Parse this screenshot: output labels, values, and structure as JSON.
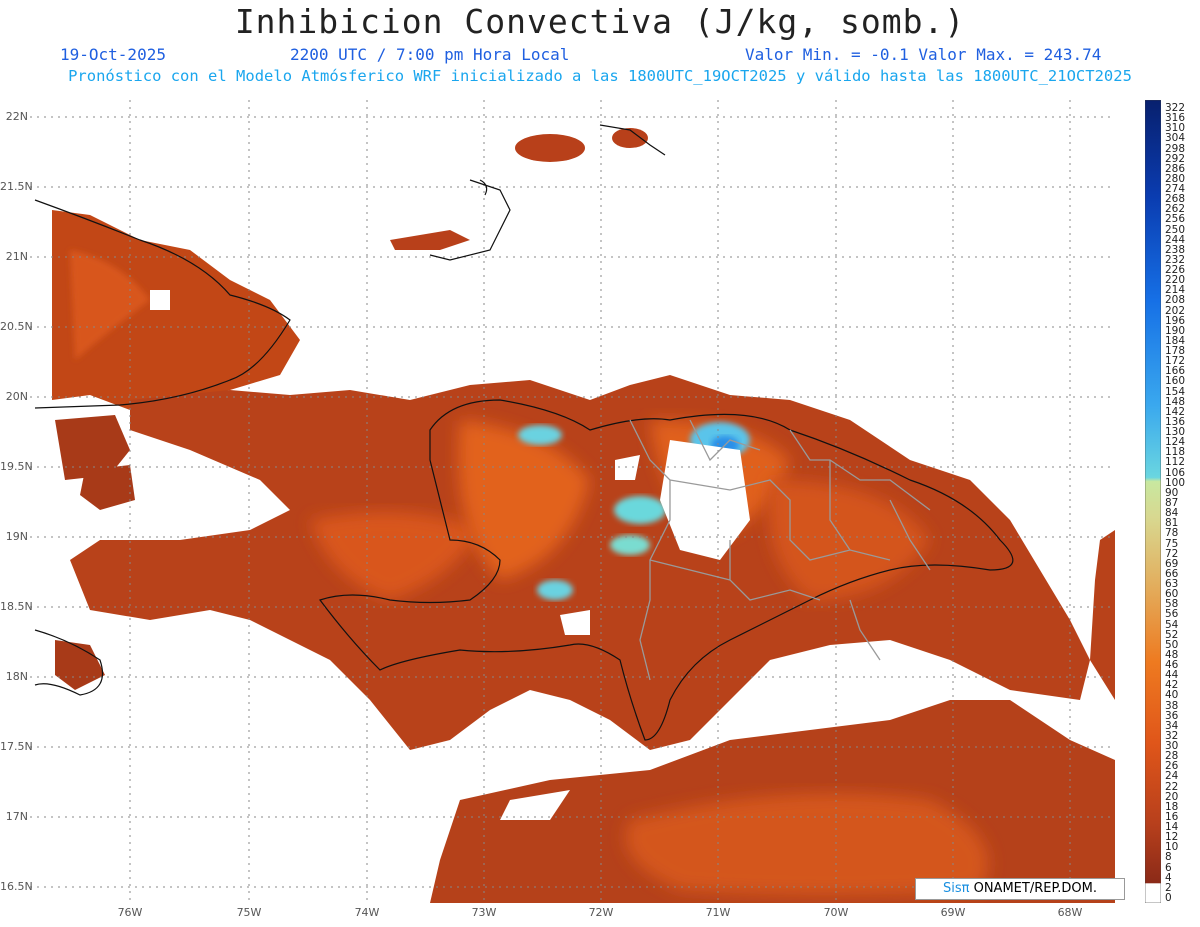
{
  "header": {
    "title": "Inhibicion Convectiva (J/kg, somb.)",
    "date": "19-Oct-2025",
    "time": "2200 UTC / 7:00 pm Hora Local",
    "range": "Valor Min. = -0.1  Valor Max. = 243.74",
    "description": "Pronóstico con el Modelo Atmósferico WRF inicializado a las 1800UTC_19OCT2025 y válido hasta las  1800UTC_21OCT2025"
  },
  "map": {
    "lat_labels": [
      "22N",
      "21.5N",
      "21N",
      "20.5N",
      "20N",
      "19.5N",
      "19N",
      "18.5N",
      "18N",
      "17.5N",
      "17N",
      "16.5N"
    ],
    "lon_labels": [
      "76W",
      "75W",
      "74W",
      "73W",
      "72W",
      "71W",
      "70W",
      "69W",
      "68W"
    ],
    "colors": {
      "low": "#8b2e1c",
      "mid": "#c94a1a",
      "high": "#e86a1c",
      "cyan": "#5ad0e0",
      "blue": "#2b8fe8",
      "coast": "#111111",
      "border": "#9a9a9a"
    }
  },
  "colorbar": {
    "labels": [
      "322",
      "316",
      "310",
      "304",
      "298",
      "292",
      "286",
      "280",
      "274",
      "268",
      "262",
      "256",
      "250",
      "244",
      "238",
      "232",
      "226",
      "220",
      "214",
      "208",
      "202",
      "196",
      "190",
      "184",
      "178",
      "172",
      "166",
      "160",
      "154",
      "148",
      "142",
      "136",
      "130",
      "124",
      "118",
      "112",
      "106",
      "100",
      "90",
      "87",
      "84",
      "81",
      "78",
      "75",
      "72",
      "69",
      "66",
      "63",
      "60",
      "58",
      "56",
      "54",
      "52",
      "50",
      "48",
      "46",
      "44",
      "42",
      "40",
      "38",
      "36",
      "34",
      "32",
      "30",
      "28",
      "26",
      "24",
      "22",
      "20",
      "18",
      "16",
      "14",
      "12",
      "10",
      "8",
      "6",
      "4",
      "2",
      "0"
    ]
  },
  "credit": {
    "logo": "Sisπ",
    "text": " ONAMET/REP.DOM."
  }
}
